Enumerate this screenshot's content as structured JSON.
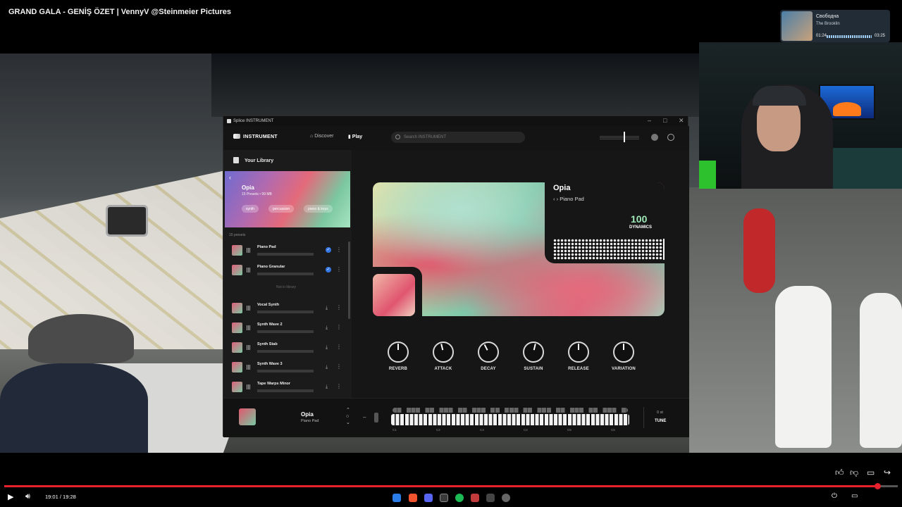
{
  "video": {
    "title": "GRAND GALA - GENİŞ ÖZET | VennyV  @Steinmeier Pictures",
    "current_time": "19:01",
    "duration": "19:28",
    "time_display": "19:01 / 19:28",
    "progress": 0.977
  },
  "music_widget": {
    "track": "Свободна",
    "artist": "The Brooklin",
    "elapsed": "01:24",
    "total": "03:25"
  },
  "app": {
    "window_title": "Splice INSTRUMENT",
    "brand": "INSTRUMENT",
    "nav": {
      "discover": "Discover",
      "play": "Play"
    },
    "search_placeholder": "Search INSTRUMENT",
    "library_label": "Your Library",
    "hero": {
      "name": "Opia",
      "meta": "15 Presets • 99 MB",
      "tags": [
        "synth",
        "percussion",
        "piano & keys"
      ]
    },
    "presets_count": "15 presets",
    "presets_in_library": [
      {
        "name": "Piano Pad"
      },
      {
        "name": "Piano Granular"
      }
    ],
    "not_in_library_label": "Not in library",
    "presets_available": [
      {
        "name": "Vocal Synth"
      },
      {
        "name": "Synth Wave 2"
      },
      {
        "name": "Synth Stab"
      },
      {
        "name": "Synth Wave 3"
      },
      {
        "name": "Tape Warps Minor"
      }
    ],
    "instrument": {
      "name": "Opia",
      "preset": "Piano Pad",
      "dynamics_value": "100",
      "dynamics_label": "DYNAMICS"
    },
    "knobs": [
      {
        "label": "REVERB",
        "level": 0.5
      },
      {
        "label": "ATTACK",
        "level": 0.45
      },
      {
        "label": "DECAY",
        "level": 0.4
      },
      {
        "label": "SUSTAIN",
        "level": 0.55
      },
      {
        "label": "RELEASE",
        "level": 0.5
      },
      {
        "label": "VARIATION",
        "level": 0.5
      }
    ],
    "bottom": {
      "name": "Opia",
      "preset": "Piano Pad",
      "octaves": [
        "C1",
        "C2",
        "C3",
        "C4",
        "C5",
        "C6"
      ],
      "semitones": "0 st",
      "tune_label": "TUNE"
    }
  },
  "icons": {
    "window_controls": [
      "minimize-icon",
      "maximize-icon",
      "close-icon"
    ],
    "actions": [
      "like-icon",
      "dislike-icon",
      "comment-icon",
      "share-icon"
    ]
  },
  "colors": {
    "accent_progress": "#e5212d",
    "dynamics_value": "#9fe8b8",
    "check": "#3578e5"
  }
}
